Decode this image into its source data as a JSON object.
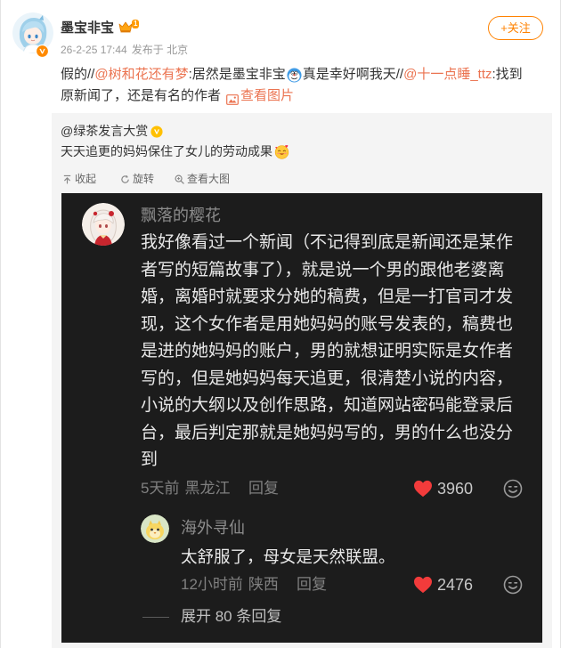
{
  "post": {
    "author": {
      "name": "墨宝非宝",
      "vip_level": "1",
      "avatar_icon": "avatar-chibi-blue-hair",
      "verified_icon": "verified-orange-v-icon",
      "vip_icon": "vip-crown-icon"
    },
    "time": "26-2-25 17:44",
    "location": "发布于 北京",
    "follow_label": "+关注",
    "text": {
      "part1": "假的//",
      "mention1": "@树和花还有梦",
      "part2": ":居然是墨宝非宝",
      "emoji1": "emoji-icon",
      "part3": "真是幸好啊我天//",
      "mention2": "@十一点睡_ttz",
      "part4": ":找到",
      "part5": "原新闻了，还是有名的作者",
      "view_image_icon": "image-icon",
      "view_image_label": "查看图片"
    }
  },
  "retweet": {
    "author": "@绿茶发言大赏",
    "author_badge_icon": "verified-yellow-v-icon",
    "text": "天天追更的妈妈保住了女儿的劳动成果",
    "emoji": "love-face-emoji-icon",
    "toolbar": {
      "collapse_label": "收起",
      "rotate_label": "旋转",
      "view_large_label": "查看大图"
    }
  },
  "image": {
    "comment": {
      "username": "飘落的樱花",
      "text_lines": [
        "我好像看过一个新闻（不记得到底是新闻还是某作",
        "者写的短篇故事了），就是说一个男的跟他老婆离",
        "婚，离婚时就要求分她的稿费，但是一打官司才发",
        "现，这个女作者是用她妈妈的账号发表的，稿费也",
        "是进的她妈妈的账户，男的就想证明实际是女作者",
        "写的，但是她妈妈每天追更，很清楚小说的内容，",
        "小说的大纲以及创作思路，知道网站密码能登录后",
        "台，最后判定那就是她妈妈写的，男的什么也没分",
        "到"
      ],
      "time": "5天前",
      "location": "黑龙江",
      "reply_label": "回复",
      "likes": "3960"
    },
    "reply": {
      "username": "海外寻仙",
      "text": "太舒服了，母女是天然联盟。",
      "time": "12小时前",
      "location": "陕西",
      "reply_label": "回复",
      "likes": "2476"
    },
    "expand_label": "展开 80 条回复"
  },
  "colors": {
    "follow_accent": "#ff8200",
    "mention": "#eb7350",
    "like_heart": "#f23b3b",
    "image_background": "#1c1c1c",
    "retweet_background": "#f4f4f4"
  }
}
